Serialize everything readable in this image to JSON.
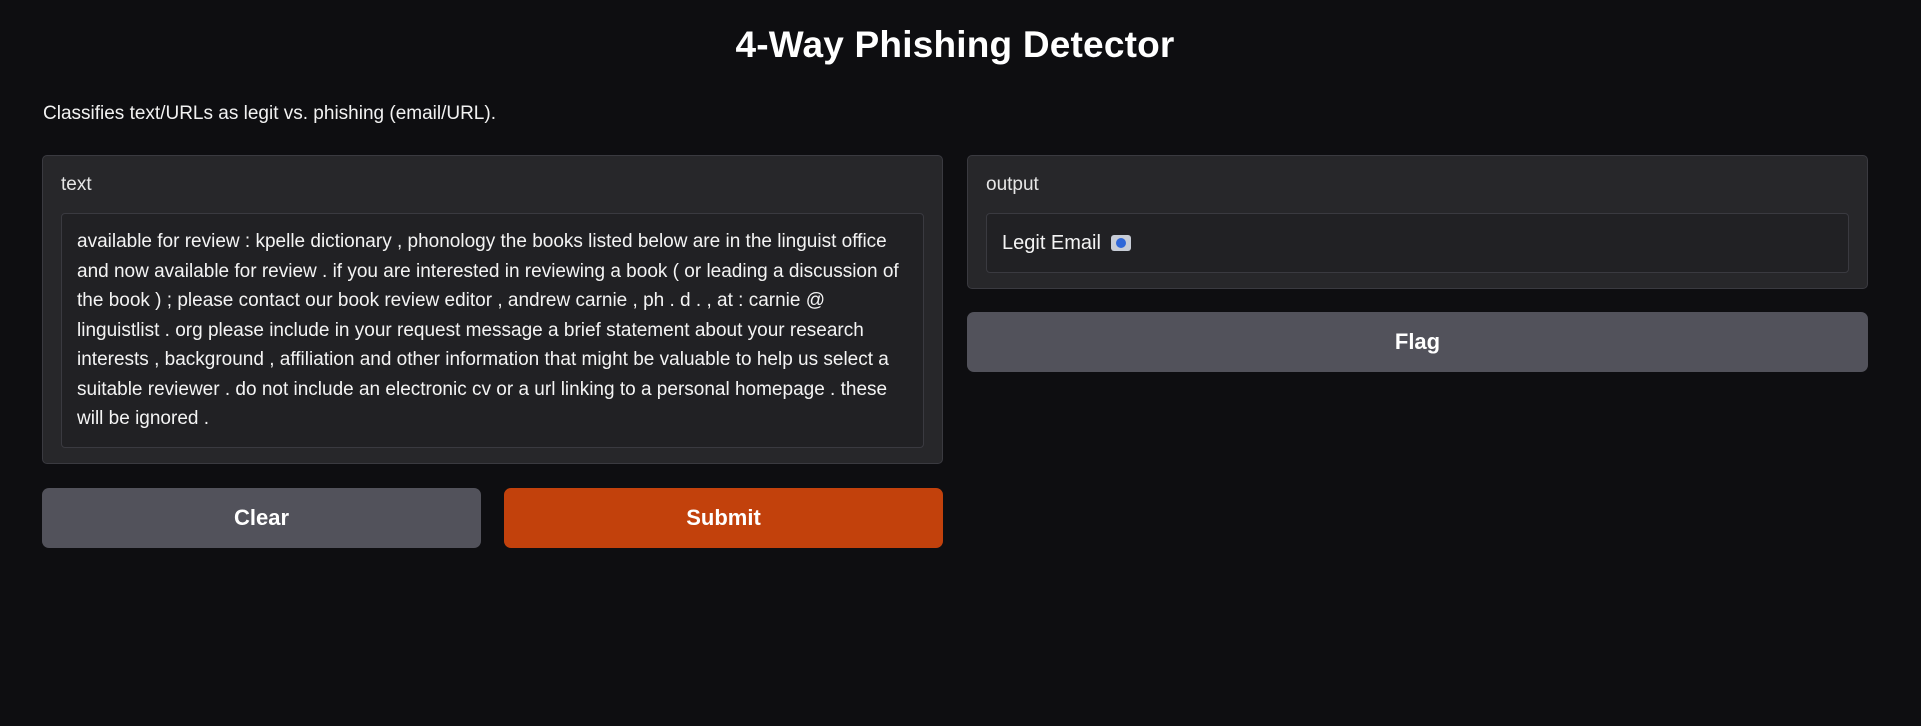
{
  "app": {
    "title": "4-Way Phishing Detector",
    "description": "Classifies text/URLs as legit vs. phishing (email/URL)."
  },
  "input": {
    "label": "text",
    "value": "available for review : kpelle dictionary , phonology the books listed below are in the linguist office and now available for review . if you are interested in reviewing a book ( or leading a discussion of the book ) ; please contact our book review editor , andrew carnie , ph . d . , at : carnie @ linguistlist . org please include in your request message a brief statement about your research interests , background , affiliation and other information that might be valuable to help us select a suitable reviewer . do not include an electronic cv or a url linking to a personal homepage . these will be ignored ."
  },
  "output": {
    "label": "output",
    "value": "Legit Email",
    "icon": "blue-circle-emoji-icon"
  },
  "buttons": {
    "clear": "Clear",
    "submit": "Submit",
    "flag": "Flag"
  },
  "colors": {
    "background": "#0e0e11",
    "panel": "#27272a",
    "secondary_button": "#52525b",
    "primary_button": "#c2410c"
  }
}
